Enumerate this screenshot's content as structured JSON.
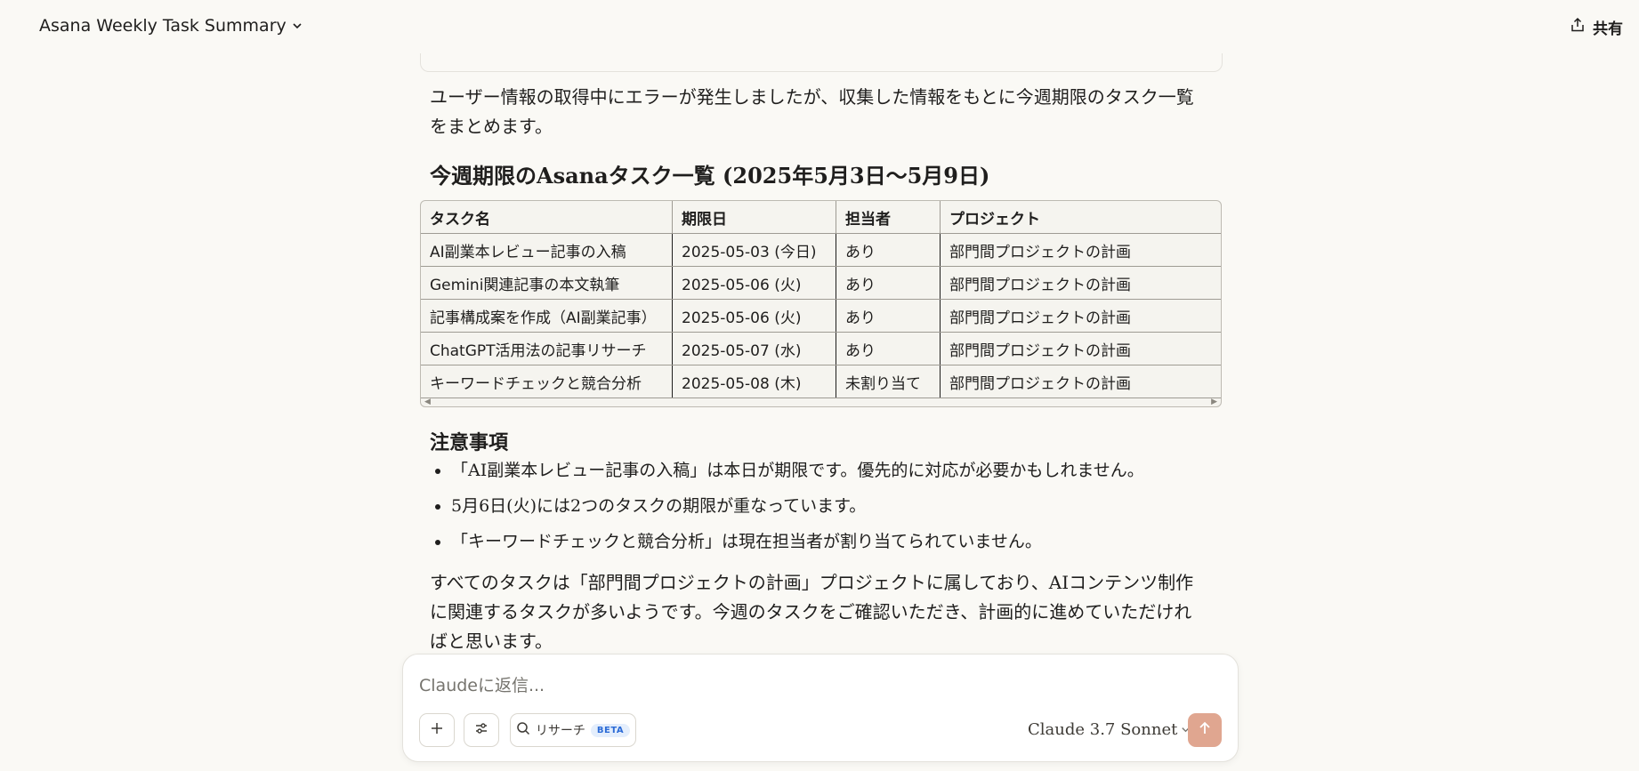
{
  "header": {
    "title": "Asana Weekly Task Summary",
    "share_label": "共有"
  },
  "message": {
    "intro": "ユーザー情報の取得中にエラーが発生しましたが、収集した情報をもとに今週期限のタスク一覧をまとめます。",
    "heading": "今週期限のAsanaタスク一覧 (2025年5月3日〜5月9日)",
    "table": {
      "headers": [
        "タスク名",
        "期限日",
        "担当者",
        "プロジェクト"
      ],
      "rows": [
        [
          "AI副業本レビュー記事の入稿",
          "2025-05-03 (今日)",
          "あり",
          "部門間プロジェクトの計画"
        ],
        [
          "Gemini関連記事の本文執筆",
          "2025-05-06 (火)",
          "あり",
          "部門間プロジェクトの計画"
        ],
        [
          "記事構成案を作成（AI副業記事）",
          "2025-05-06 (火)",
          "あり",
          "部門間プロジェクトの計画"
        ],
        [
          "ChatGPT活用法の記事リサーチ",
          "2025-05-07 (水)",
          "あり",
          "部門間プロジェクトの計画"
        ],
        [
          "キーワードチェックと競合分析",
          "2025-05-08 (木)",
          "未割り当て",
          "部門間プロジェクトの計画"
        ]
      ]
    },
    "notes_heading": "注意事項",
    "notes": [
      "「AI副業本レビュー記事の入稿」は本日が期限です。優先的に対応が必要かもしれません。",
      "5月6日(火)には2つのタスクの期限が重なっています。",
      "「キーワードチェックと競合分析」は現在担当者が割り当てられていません。"
    ],
    "closing": "すべてのタスクは「部門間プロジェクトの計画」プロジェクトに属しており、AIコンテンツ制作に関連するタスクが多いようです。今週のタスクをご確認いただき、計画的に進めていただければと思います。"
  },
  "composer": {
    "placeholder": "Claudeに返信...",
    "research_label": "リサーチ",
    "beta_label": "BETA",
    "model_label": "Claude 3.7 Sonnet"
  },
  "colors": {
    "background": "#faf9f5",
    "send_button": "#e0a690",
    "beta_text": "#2c6bd6"
  },
  "icons": [
    "chevron-down-icon",
    "share-icon",
    "plus-icon",
    "sliders-icon",
    "search-icon",
    "arrow-up-icon"
  ]
}
